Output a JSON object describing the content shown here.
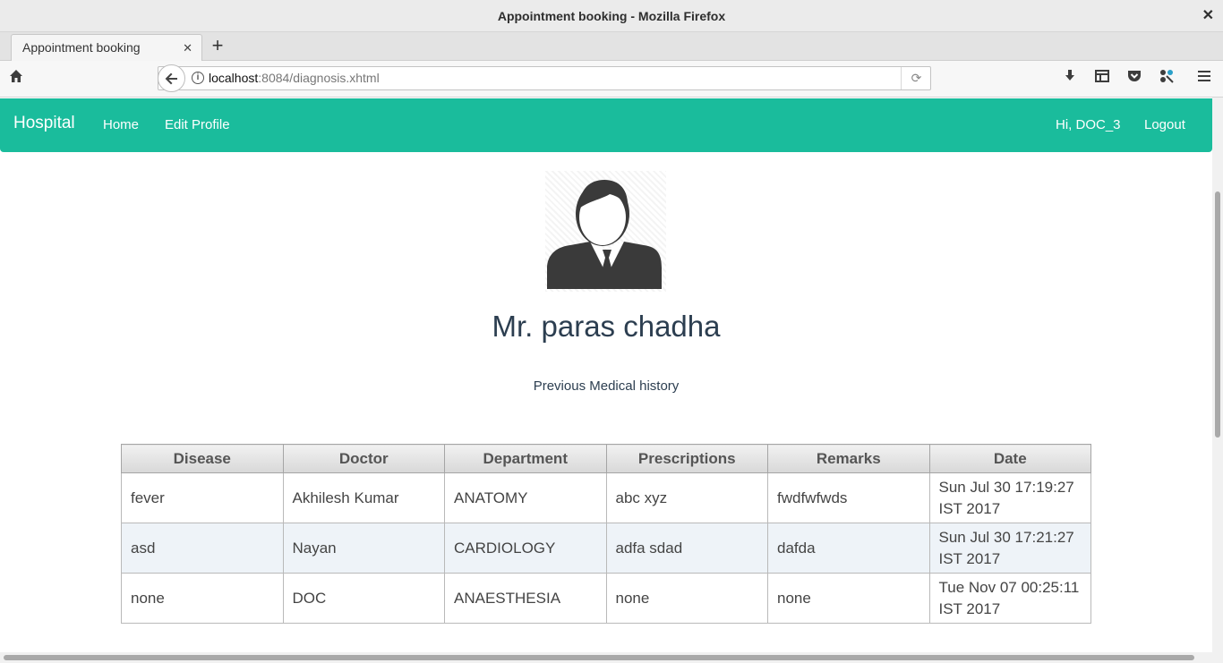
{
  "window": {
    "title": "Appointment booking - Mozilla Firefox",
    "close_glyph": "✕"
  },
  "browser": {
    "tab": {
      "label": "Appointment booking",
      "close_glyph": "✕"
    },
    "new_tab_glyph": "+",
    "url": {
      "host": "localhost",
      "rest": ":8084/diagnosis.xhtml"
    }
  },
  "app": {
    "brand": "Hospital",
    "nav": {
      "home": "Home",
      "edit_profile": "Edit Profile",
      "greeting": "Hi, DOC_3",
      "logout": "Logout"
    },
    "accent_color": "#1abc9c"
  },
  "patient": {
    "name": "Mr. paras chadha",
    "history_label": "Previous Medical history"
  },
  "history_table": {
    "headers": [
      "Disease",
      "Doctor",
      "Department",
      "Prescriptions",
      "Remarks",
      "Date"
    ],
    "rows": [
      [
        "fever",
        "Akhilesh Kumar",
        "ANATOMY",
        "abc xyz",
        "fwdfwfwds",
        "Sun Jul 30 17:19:27 IST 2017"
      ],
      [
        "asd",
        "Nayan",
        "CARDIOLOGY",
        "adfa sdad",
        "dafda",
        "Sun Jul 30 17:21:27 IST 2017"
      ],
      [
        "none",
        "DOC",
        "ANAESTHESIA",
        "none",
        "none",
        "Tue Nov 07 00:25:11 IST 2017"
      ]
    ]
  }
}
